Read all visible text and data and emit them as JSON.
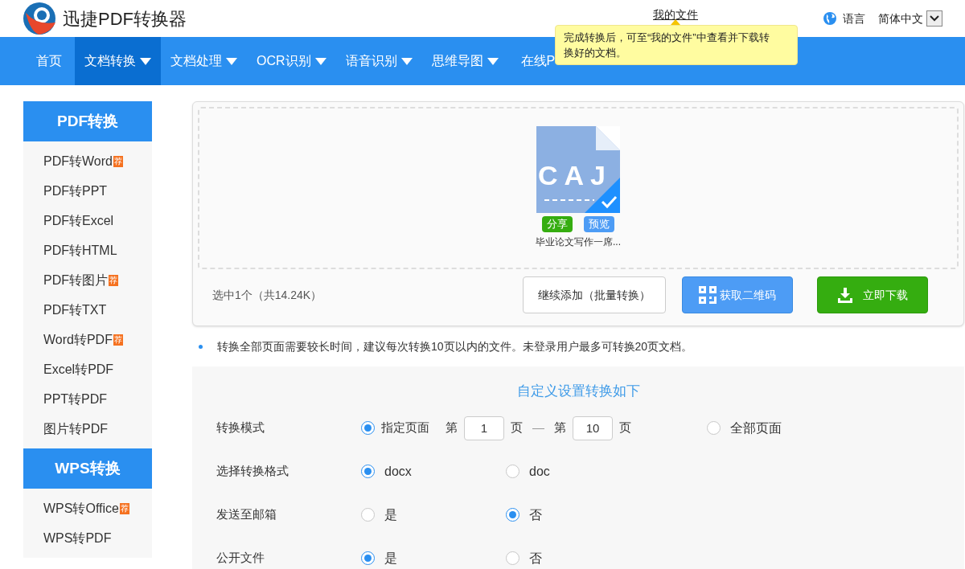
{
  "header": {
    "logo_text": "迅捷PDF转换器",
    "my_files": "我的文件",
    "language_label": "语言",
    "language_value": "简体中文"
  },
  "tooltip": "完成转换后，可至“我的文件”中查看并下载转换好的文档。",
  "nav": [
    {
      "label": "首页",
      "selected": false,
      "dropdown": false
    },
    {
      "label": "文档转换",
      "selected": true,
      "dropdown": true
    },
    {
      "label": "文档处理",
      "selected": false,
      "dropdown": true
    },
    {
      "label": "OCR识别",
      "selected": false,
      "dropdown": true
    },
    {
      "label": "语音识别",
      "selected": false,
      "dropdown": true
    },
    {
      "label": "思维导图",
      "selected": false,
      "dropdown": true
    },
    {
      "label": "在线P",
      "selected": false,
      "dropdown": false
    }
  ],
  "sidebar": [
    {
      "title": "PDF转换",
      "items": [
        {
          "label": "PDF转Word",
          "badge": "荐"
        },
        {
          "label": "PDF转PPT"
        },
        {
          "label": "PDF转Excel"
        },
        {
          "label": "PDF转HTML"
        },
        {
          "label": "PDF转图片",
          "badge": "荐"
        },
        {
          "label": "PDF转TXT"
        },
        {
          "label": "Word转PDF",
          "badge": "荐"
        },
        {
          "label": "Excel转PDF"
        },
        {
          "label": "PPT转PDF"
        },
        {
          "label": "图片转PDF"
        }
      ]
    },
    {
      "title": "WPS转换",
      "items": [
        {
          "label": "WPS转Office",
          "badge": "荐"
        },
        {
          "label": "WPS转PDF"
        }
      ]
    }
  ],
  "file": {
    "type_text": "CAJ",
    "checked": true,
    "share": "分享",
    "preview": "预览",
    "name": "毕业论文写作一席..."
  },
  "selection_info": "选中1个（共14.24K）",
  "buttons": {
    "add_more": "继续添加（批量转换）",
    "qr_code": "获取二维码",
    "download": "立即下载"
  },
  "notice": "转换全部页面需要较长时间，建议每次转换10页以内的文件。未登录用户最多可转换20页文档。",
  "settings": {
    "title": "自定义设置转换如下",
    "rows": [
      {
        "label": "转换模式",
        "options": [
          {
            "kind": "range",
            "label": "指定页面",
            "selected": true,
            "from_prefix": "第",
            "from": "1",
            "from_unit": "页",
            "dash": "—",
            "to_prefix": "第",
            "to": "10",
            "to_unit": "页"
          },
          {
            "kind": "plain",
            "label": "全部页面",
            "selected": false
          }
        ]
      },
      {
        "label": "选择转换格式",
        "options": [
          {
            "kind": "plain",
            "label": "docx",
            "selected": true
          },
          {
            "kind": "plain",
            "label": "doc",
            "selected": false
          }
        ]
      },
      {
        "label": "发送至邮箱",
        "options": [
          {
            "kind": "plain",
            "label": "是",
            "selected": false
          },
          {
            "kind": "plain",
            "label": "否",
            "selected": true
          }
        ]
      },
      {
        "label": "公开文件",
        "options": [
          {
            "kind": "plain",
            "label": "是",
            "selected": true
          },
          {
            "kind": "plain",
            "label": "否",
            "selected": false
          }
        ]
      }
    ]
  }
}
